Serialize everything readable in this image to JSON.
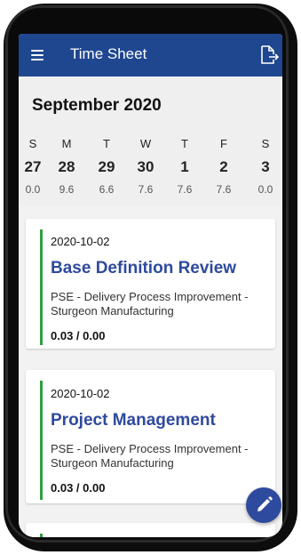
{
  "app": {
    "title": "Time Sheet"
  },
  "icons": {
    "menu": "menu-icon",
    "export": "export-icon",
    "edit": "edit-pencil-icon"
  },
  "colors": {
    "appbar": "#1f4790",
    "accent": "#2e4a9e",
    "status_bar": "#2e9e3e"
  },
  "calendar": {
    "month_label": "September 2020",
    "days": [
      {
        "dow": "S",
        "date": "27",
        "hours": "0.0"
      },
      {
        "dow": "M",
        "date": "28",
        "hours": "9.6"
      },
      {
        "dow": "T",
        "date": "29",
        "hours": "6.6"
      },
      {
        "dow": "W",
        "date": "30",
        "hours": "7.6"
      },
      {
        "dow": "T",
        "date": "1",
        "hours": "7.6"
      },
      {
        "dow": "F",
        "date": "2",
        "hours": "7.6"
      },
      {
        "dow": "S",
        "date": "3",
        "hours": "0.0"
      }
    ]
  },
  "entries": [
    {
      "date": "2020-10-02",
      "title": "Base Definition Review",
      "description": "PSE - Delivery Process Improvement - Sturgeon Manufacturing",
      "hours": "0.03 / 0.00"
    },
    {
      "date": "2020-10-02",
      "title": "Project Management",
      "description": "PSE - Delivery Process Improvement - Sturgeon Manufacturing",
      "hours": "0.03 / 0.00"
    }
  ]
}
